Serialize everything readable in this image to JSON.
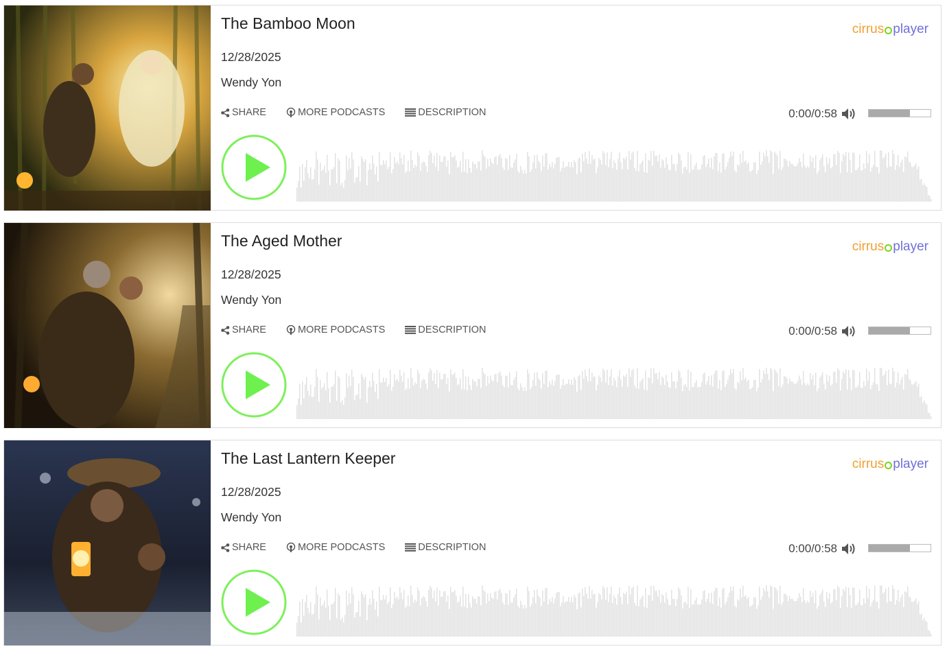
{
  "episodes": [
    {
      "title": "The Bamboo Moon",
      "date": "12/28/2025",
      "author": "Wendy Yon",
      "time": "0:00/0:58",
      "volume": 0.67,
      "art_theme": "bamboo"
    },
    {
      "title": "The Aged Mother",
      "date": "12/28/2025",
      "author": "Wendy Yon",
      "time": "0:00/0:58",
      "volume": 0.67,
      "art_theme": "forest"
    },
    {
      "title": "The Last Lantern Keeper",
      "date": "12/28/2025",
      "author": "Wendy Yon",
      "time": "0:00/0:58",
      "volume": 0.67,
      "art_theme": "snow"
    }
  ],
  "labels": {
    "share": "SHARE",
    "more_podcasts": "MORE PODCASTS",
    "description": "DESCRIPTION",
    "logo_left": "cirrus",
    "logo_right": "player"
  },
  "icons": {
    "share": "share-icon",
    "podcast": "podcast-icon",
    "description": "list-icon",
    "volume": "volume-icon",
    "play": "play-icon"
  },
  "colors": {
    "play_accent": "#7cf05a",
    "play_fill": "#6ef04f",
    "waveform": "#e0e0e0",
    "logo_orange": "#f0a030",
    "logo_purple": "#6f6fd8",
    "logo_green": "#7ed321",
    "volume_fill": "#aaaaaa"
  }
}
